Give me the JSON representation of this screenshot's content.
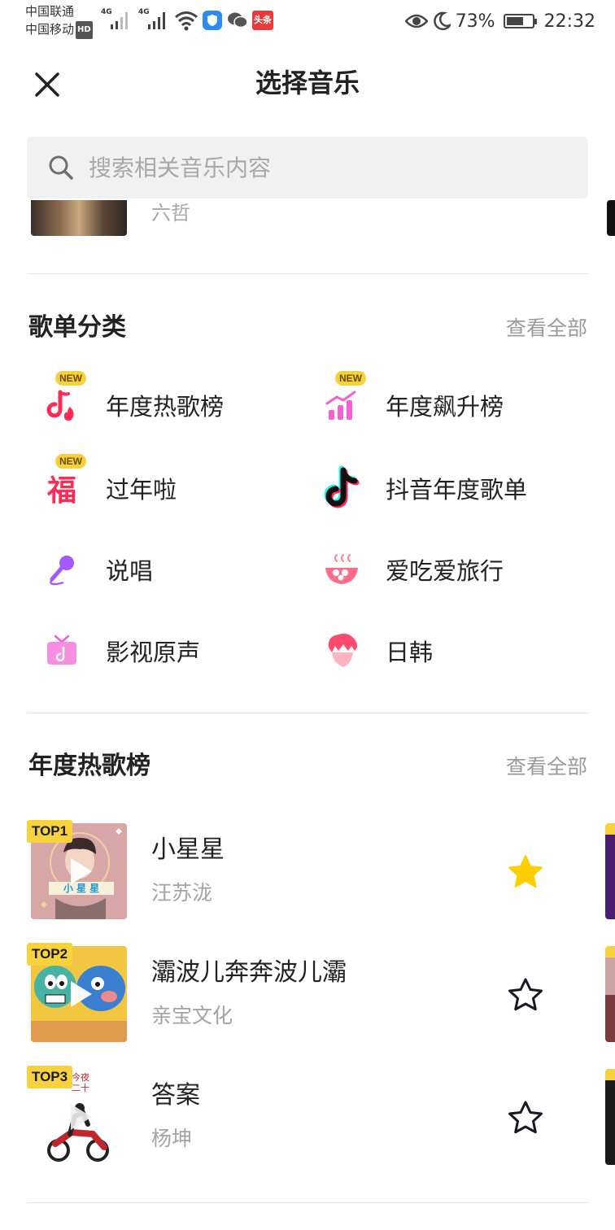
{
  "status_bar": {
    "carrier1": "中国联通",
    "carrier2": "中国移动",
    "hd": "HD",
    "net1": "4G",
    "net2": "4G",
    "battery": "73%",
    "battery_level": 0.73,
    "time": "22:32",
    "app_badge": "头条"
  },
  "header": {
    "title": "选择音乐"
  },
  "search": {
    "placeholder": "搜索相关音乐内容"
  },
  "peek_row": {
    "subtitle": "六哲"
  },
  "playlist_categories": {
    "title": "歌单分类",
    "see_all": "查看全部",
    "badge": "NEW",
    "items": [
      {
        "label": "年度热歌榜",
        "icon": "fire-note-icon",
        "new": true
      },
      {
        "label": "年度飙升榜",
        "icon": "rising-chart-icon",
        "new": true
      },
      {
        "label": "过年啦",
        "icon": "fu-icon",
        "new": true
      },
      {
        "label": "抖音年度歌单",
        "icon": "tiktok-icon",
        "new": false
      },
      {
        "label": "说唱",
        "icon": "microphone-icon",
        "new": false
      },
      {
        "label": "爱吃爱旅行",
        "icon": "food-bowl-icon",
        "new": false
      },
      {
        "label": "影视原声",
        "icon": "tv-icon",
        "new": false
      },
      {
        "label": "日韩",
        "icon": "hair-head-icon",
        "new": false
      }
    ],
    "colors": {
      "pink": "#fe2c55",
      "purple": "#a259ff",
      "tv": "#f55fd0"
    }
  },
  "hot_chart": {
    "title": "年度热歌榜",
    "see_all": "查看全部",
    "songs": [
      {
        "rank": "TOP1",
        "title": "小星星",
        "artist": "汪苏泷",
        "favorited": true,
        "cover_text": "小 星 星"
      },
      {
        "rank": "TOP2",
        "title": "灞波儿奔奔波儿灞",
        "artist": "亲宝文化",
        "favorited": false
      },
      {
        "rank": "TOP3",
        "title": "答案",
        "artist": "杨坤",
        "favorited": false,
        "cover_text": "今夜 二十"
      }
    ],
    "star_color": "#fece00"
  }
}
